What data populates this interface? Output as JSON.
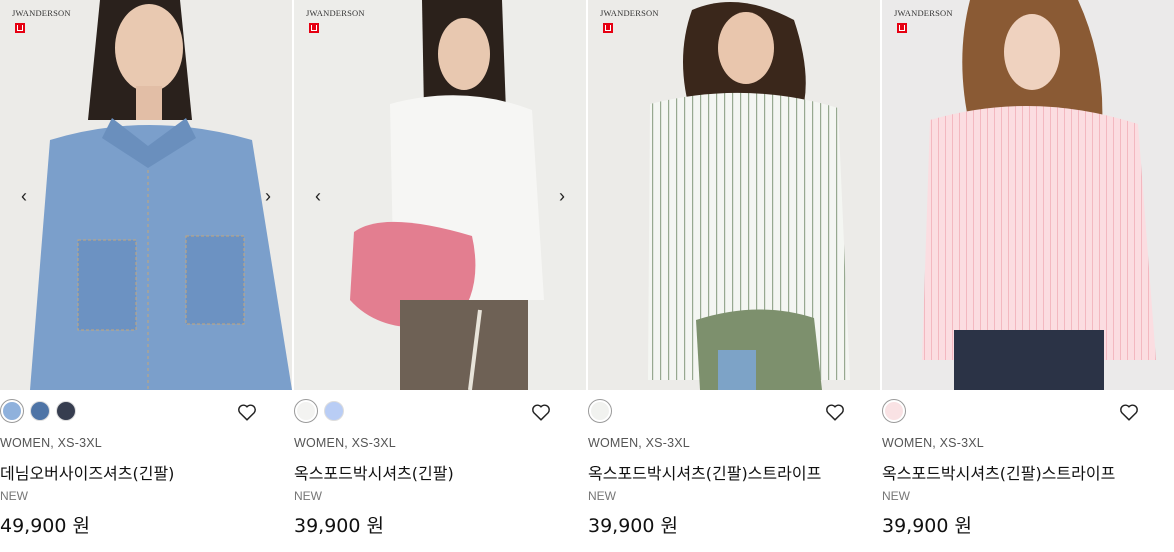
{
  "products": [
    {
      "brand_mark": "JWANDERSON",
      "image_alt": "denim shirt model",
      "swatches": [
        "#8fb1dc",
        "#4e74a6",
        "#363d4f"
      ],
      "category": "WOMEN,  XS-3XL",
      "name": "데님오버사이즈셔츠(긴팔)",
      "badge": "NEW",
      "price": "49,900 원",
      "has_arrows": true
    },
    {
      "brand_mark": "JWANDERSON",
      "image_alt": "white oxford shirt model",
      "swatches": [
        "#f3f3f1",
        "#b9cdf5"
      ],
      "category": "WOMEN,  XS-3XL",
      "name": "옥스포드박시셔츠(긴팔)",
      "badge": "NEW",
      "price": "39,900 원",
      "has_arrows": true
    },
    {
      "brand_mark": "JWANDERSON",
      "image_alt": "striped oxford shirt model",
      "swatches": [
        "#f1f2ef"
      ],
      "category": "WOMEN,  XS-3XL",
      "name": "옥스포드박시셔츠(긴팔)스트라이프",
      "badge": "NEW",
      "price": "39,900 원",
      "has_arrows": false
    },
    {
      "brand_mark": "JWANDERSON",
      "image_alt": "pink striped shirt model",
      "swatches": [
        "#f9e2e4"
      ],
      "category": "WOMEN,  XS-3XL",
      "name": "옥스포드박시셔츠(긴팔)스트라이프",
      "badge": "NEW",
      "price": "39,900 원",
      "has_arrows": false
    }
  ],
  "icons": {
    "prev": "‹",
    "next": "›",
    "wishlist": "heart-outline-icon"
  }
}
